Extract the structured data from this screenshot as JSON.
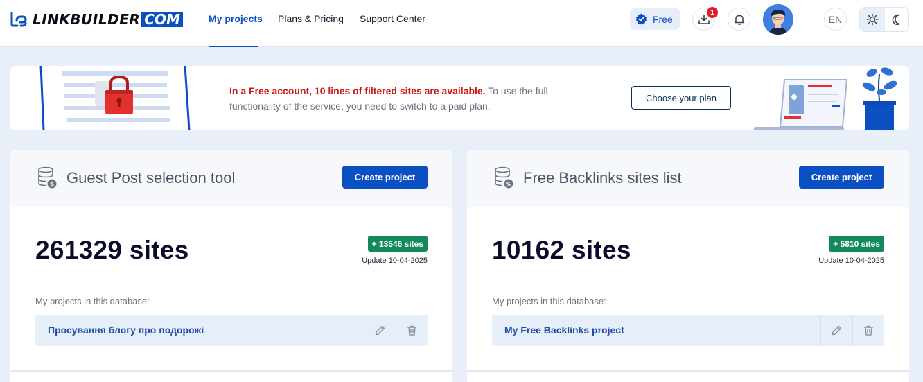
{
  "header": {
    "logo_text": "LINKBUILDER",
    "logo_com": "COM",
    "nav": [
      {
        "label": "My projects",
        "active": true
      },
      {
        "label": "Plans & Pricing",
        "active": false
      },
      {
        "label": "Support Center",
        "active": false
      }
    ],
    "plan_badge": "Free",
    "downloads_count": "1",
    "language": "EN",
    "icons": [
      "logo-icon",
      "verified-check-icon",
      "download-icon",
      "bell-icon",
      "user-avatar",
      "sun-icon",
      "moon-icon"
    ]
  },
  "banner": {
    "warning": "In a Free account, 10 lines of filtered sites are available.",
    "text": " To use the full functionality of the service, you need to switch to a paid plan.",
    "button": "Choose your plan"
  },
  "cards": [
    {
      "title": "Guest Post selection tool",
      "icon": "database-dollar-icon",
      "create_button": "Create project",
      "sites": "261329 sites",
      "delta": "+ 13546 sites",
      "update": "Update 10-04-2025",
      "projects_label": "My projects in this database:",
      "projects": [
        {
          "name": "Просування блогу про подорожі"
        }
      ]
    },
    {
      "title": "Free Backlinks sites list",
      "icon": "database-percent-icon",
      "create_button": "Create project",
      "sites": "10162 sites",
      "delta": "+ 5810 sites",
      "update": "Update 10-04-2025",
      "projects_label": "My projects in this database:",
      "projects": [
        {
          "name": "My Free Backlinks project"
        }
      ]
    }
  ],
  "colors": {
    "accent": "#0a50c2",
    "warning": "#cc1b1b",
    "success": "#138a5a",
    "background": "#e9eff8"
  }
}
